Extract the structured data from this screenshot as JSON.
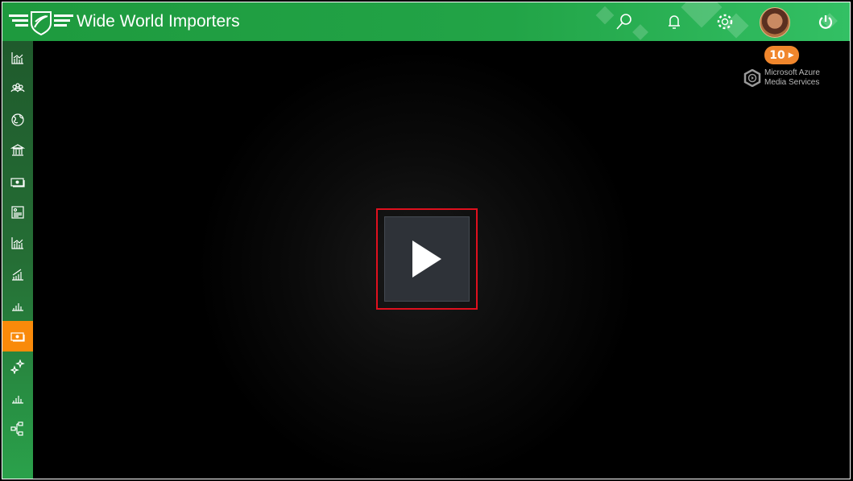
{
  "header": {
    "title": "Wide World Importers",
    "icons": [
      "search-icon",
      "bell-icon",
      "gear-icon",
      "avatar",
      "power-icon"
    ]
  },
  "sidebar": {
    "items": [
      {
        "icon": "line-chart-icon"
      },
      {
        "icon": "people-icon"
      },
      {
        "icon": "globe-icon"
      },
      {
        "icon": "bank-icon"
      },
      {
        "icon": "money-icon"
      },
      {
        "icon": "document-icon"
      },
      {
        "icon": "line-chart-icon"
      },
      {
        "icon": "growth-chart-icon"
      },
      {
        "icon": "bar-chart-icon"
      },
      {
        "icon": "money-icon",
        "active": true
      },
      {
        "icon": "sparkles-icon"
      },
      {
        "icon": "bar-chart-icon"
      },
      {
        "icon": "org-chart-icon"
      }
    ]
  },
  "player": {
    "skip_badge": "10",
    "provider_line1": "Microsoft Azure",
    "provider_line2": "Media Services"
  },
  "colors": {
    "header_green": "#22a447",
    "active_orange": "#f98a0a",
    "badge_orange": "#f0862c",
    "highlight_red": "#e0101e"
  }
}
